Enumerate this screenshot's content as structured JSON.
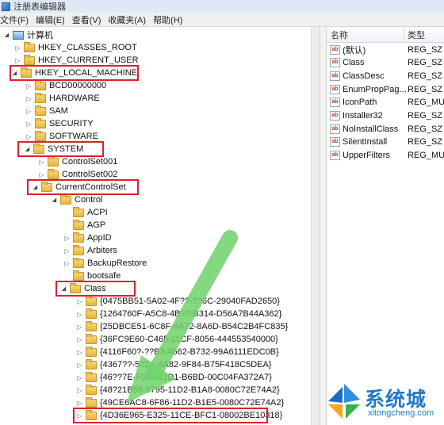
{
  "window": {
    "title": "注册表编辑器"
  },
  "menu": [
    "文件(F)",
    "编辑(E)",
    "查看(V)",
    "收藏夹(A)",
    "帮助(H)"
  ],
  "tree": [
    {
      "label": "计算机",
      "toggle": "expanded",
      "icon": "computer-icon"
    },
    {
      "label": "HKEY_CLASSES_ROOT",
      "toggle": "collapsed",
      "icon": "folder-icon"
    },
    {
      "label": "HKEY_CURRENT_USER",
      "toggle": "collapsed",
      "icon": "folder-icon"
    },
    {
      "label": "HKEY_LOCAL_MACHINE",
      "toggle": "expanded",
      "icon": "folder-icon"
    },
    {
      "label": "BCD00000000",
      "toggle": "collapsed",
      "icon": "folder-icon"
    },
    {
      "label": "HARDWARE",
      "toggle": "collapsed",
      "icon": "folder-icon"
    },
    {
      "label": "SAM",
      "toggle": "collapsed",
      "icon": "folder-icon"
    },
    {
      "label": "SECURITY",
      "toggle": "collapsed",
      "icon": "folder-icon"
    },
    {
      "label": "SOFTWARE",
      "toggle": "collapsed",
      "icon": "folder-icon"
    },
    {
      "label": "SYSTEM",
      "toggle": "expanded",
      "icon": "folder-icon"
    },
    {
      "label": "ControlSet001",
      "toggle": "collapsed",
      "icon": "folder-icon"
    },
    {
      "label": "ControlSet002",
      "toggle": "collapsed",
      "icon": "folder-icon"
    },
    {
      "label": "CurrentControlSet",
      "toggle": "expanded",
      "icon": "folder-icon"
    },
    {
      "label": "Control",
      "toggle": "expanded",
      "icon": "folder-icon"
    },
    {
      "label": "ACPI",
      "toggle": "none",
      "icon": "folder-icon"
    },
    {
      "label": "AGP",
      "toggle": "none",
      "icon": "folder-icon"
    },
    {
      "label": "AppID",
      "toggle": "collapsed",
      "icon": "folder-icon"
    },
    {
      "label": "Arbiters",
      "toggle": "collapsed",
      "icon": "folder-icon"
    },
    {
      "label": "BackupRestore",
      "toggle": "collapsed",
      "icon": "folder-icon"
    },
    {
      "label": "bootsafe",
      "toggle": "none",
      "icon": "folder-icon"
    },
    {
      "label": "Class",
      "toggle": "expanded",
      "icon": "folder-icon"
    },
    {
      "label": "{0475BB51-5A02-4F??-??6C-29040FAD2650}",
      "toggle": "collapsed",
      "icon": "folder-icon"
    },
    {
      "label": "{1264760F-A5C8-4B??-B314-D56A7B44A362}",
      "toggle": "collapsed",
      "icon": "folder-icon"
    },
    {
      "label": "{25DBCE51-6C8F-4A72-8A6D-B54C2B4FC835}",
      "toggle": "collapsed",
      "icon": "folder-icon"
    },
    {
      "label": "{36FC9E60-C465-11CF-8056-444553540000}",
      "toggle": "collapsed",
      "icon": "folder-icon"
    },
    {
      "label": "{4116F60?-??B3-4662-B732-99A6111EDC0B}",
      "toggle": "collapsed",
      "icon": "folder-icon"
    },
    {
      "label": "{4367??-502A-4A82-9F84-B75F418C5DEA}",
      "toggle": "collapsed",
      "icon": "folder-icon"
    },
    {
      "label": "{46??7E-F050-11D1-B6BD-00C04FA372A7}",
      "toggle": "collapsed",
      "icon": "folder-icon"
    },
    {
      "label": "{48?21B56-6795-11D2-B1A8-0080C72E74A2}",
      "toggle": "collapsed",
      "icon": "folder-icon"
    },
    {
      "label": "{49CE6AC8-6F86-11D2-B1E5-0080C72E74A2}",
      "toggle": "collapsed",
      "icon": "folder-icon"
    },
    {
      "label": "{4D36E965-E325-11CE-BFC1-08002BE10318}",
      "toggle": "collapsed",
      "icon": "folder-icon"
    }
  ],
  "values": {
    "columns": {
      "name": "名称",
      "type": "类型"
    },
    "rows": [
      {
        "name": "(默认)",
        "type": "REG_SZ"
      },
      {
        "name": "Class",
        "type": "REG_SZ"
      },
      {
        "name": "ClassDesc",
        "type": "REG_SZ"
      },
      {
        "name": "EnumPropPag...",
        "type": "REG_SZ"
      },
      {
        "name": "IconPath",
        "type": "REG_MULT"
      },
      {
        "name": "Installer32",
        "type": "REG_SZ"
      },
      {
        "name": "NoInstallClass",
        "type": "REG_SZ"
      },
      {
        "name": "SilentInstall",
        "type": "REG_SZ"
      },
      {
        "name": "UpperFilters",
        "type": "REG_MULT"
      }
    ]
  },
  "watermark": {
    "cn": "系统城",
    "en": "xitongcheng.com"
  },
  "colors": {
    "highlight": "#e01f2d",
    "arrow": "#6fd36a",
    "watermark": "#2278c8"
  }
}
